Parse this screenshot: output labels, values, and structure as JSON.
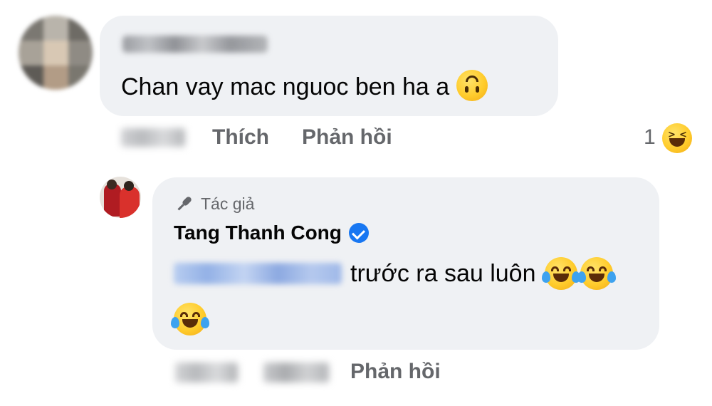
{
  "comment": {
    "text": "Chan vay mac nguoc ben ha a",
    "emoji_icon": "upside-down-face-icon",
    "actions": {
      "like_label": "Thích",
      "reply_label": "Phản hồi"
    },
    "reaction": {
      "count": "1",
      "icon": "laughing-squinting-face-icon"
    }
  },
  "reply": {
    "author_badge": "Tác giả",
    "author_name": "Tang Thanh Cong",
    "verified": true,
    "text": "trước ra sau luôn",
    "emoji_icon": "face-with-tears-of-joy-icon",
    "actions": {
      "reply_label": "Phản hồi"
    }
  },
  "colors": {
    "bubble_bg": "#eff1f4",
    "secondary_text": "#65676b",
    "verified_blue": "#1877f2"
  }
}
